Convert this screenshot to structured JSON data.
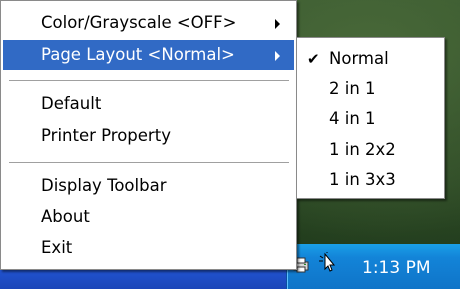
{
  "menu": {
    "items": [
      {
        "label": "Color/Grayscale <OFF>",
        "has_submenu": true
      },
      {
        "label": "Page Layout <Normal>",
        "has_submenu": true,
        "highlighted": true
      },
      {
        "label": "Default"
      },
      {
        "label": "Printer Property"
      },
      {
        "label": "Display Toolbar"
      },
      {
        "label": "About"
      },
      {
        "label": "Exit"
      }
    ]
  },
  "submenu": {
    "items": [
      {
        "label": "Normal",
        "checked": true
      },
      {
        "label": "2 in 1"
      },
      {
        "label": "4 in 1"
      },
      {
        "label": "1 in 2x2"
      },
      {
        "label": "1 in 3x3"
      }
    ],
    "check_glyph": "✔"
  },
  "taskbar": {
    "clock": "1:13 PM",
    "icons": [
      "printer-icon",
      "cursor-icon"
    ]
  },
  "colors": {
    "highlight": "#316ac5",
    "taskbar": "#245edb",
    "tray": "#1384d8"
  }
}
